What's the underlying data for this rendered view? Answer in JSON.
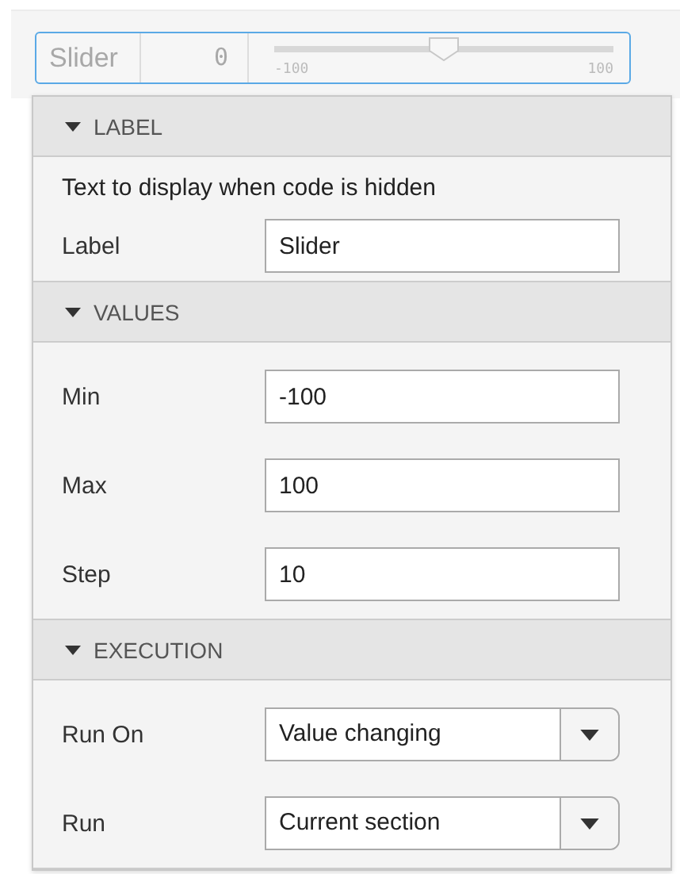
{
  "control": {
    "label": "Slider",
    "value": "0",
    "min_label": "-100",
    "max_label": "100",
    "level": 0.5
  },
  "sections": [
    {
      "title": "LABEL",
      "expanded": true,
      "rows": [
        {
          "kind": "note",
          "text": "Text to display when code is hidden"
        },
        {
          "kind": "text",
          "label": "Label",
          "value": "Slider"
        }
      ]
    },
    {
      "title": "VALUES",
      "expanded": true,
      "rows": [
        {
          "kind": "text",
          "label": "Min",
          "value": "-100"
        },
        {
          "kind": "text",
          "label": "Max",
          "value": "100"
        },
        {
          "kind": "text",
          "label": "Step",
          "value": "10"
        }
      ]
    },
    {
      "title": "EXECUTION",
      "expanded": true,
      "rows": [
        {
          "kind": "dropdown",
          "label": "Run On",
          "value": "Value changing"
        },
        {
          "kind": "dropdown",
          "label": "Run",
          "value": "Current section"
        }
      ]
    }
  ]
}
